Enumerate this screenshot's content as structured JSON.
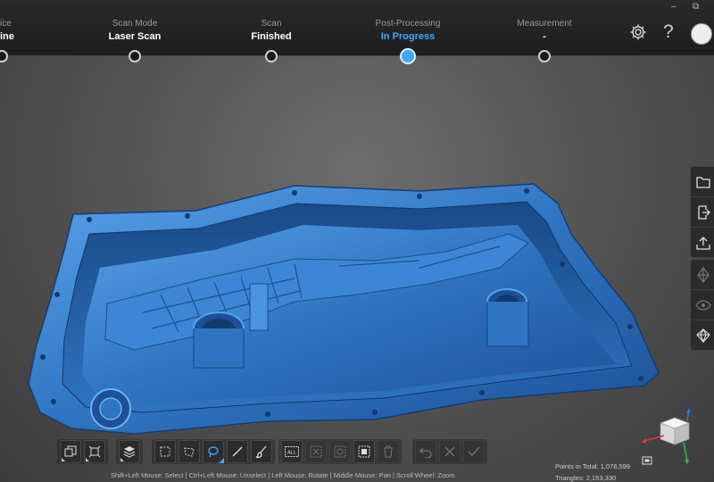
{
  "workflow": {
    "steps": [
      {
        "label": "ice",
        "value": "ine"
      },
      {
        "label": "Scan Mode",
        "value": "Laser Scan"
      },
      {
        "label": "Scan",
        "value": "Finished"
      },
      {
        "label": "Post-Processing",
        "value": "In Progress"
      },
      {
        "label": "Measurement",
        "value": "-"
      }
    ],
    "active_color": "#3fa7ff"
  },
  "window": {
    "minimize": "–",
    "restore": "⧉"
  },
  "header_icons": [
    "settings-icon",
    "help-icon",
    "user-avatar"
  ],
  "header": {
    "help_glyph": "?"
  },
  "right_toolbar": {
    "group1": [
      "open-folder-icon",
      "import-icon",
      "export-icon"
    ],
    "group2": [
      "mesh-icon",
      "visibility-eye-icon",
      "render-mode-icon"
    ]
  },
  "bottom_toolbar": {
    "all_label": "ALL",
    "groups": [
      [
        "view-layer-icon",
        "box-view-icon"
      ],
      [
        "layers-icon"
      ],
      [
        "rect-select-icon",
        "polygon-select-icon",
        "lasso-select-icon",
        "line-select-icon",
        "brush-select-icon"
      ],
      [
        "select-all-icon",
        "invert-select-icon",
        "select-connected-icon",
        "select-through-icon",
        "delete-icon"
      ],
      [
        "undo-icon",
        "cancel-icon",
        "apply-check-icon"
      ]
    ]
  },
  "status": {
    "hint": "Shift+Left Mouse: Select | Ctrl+Left Mouse: Unselect | Left Mouse: Rotate | Middle Mouse: Pan | Scroll Wheel: Zoom",
    "points": "Points in Total: 1,076,599",
    "triangles": "Triangles: 2,153,330"
  },
  "colors": {
    "model": "#2f74c0",
    "model_light": "#5aa2ea",
    "accent": "#3fa7ff"
  }
}
